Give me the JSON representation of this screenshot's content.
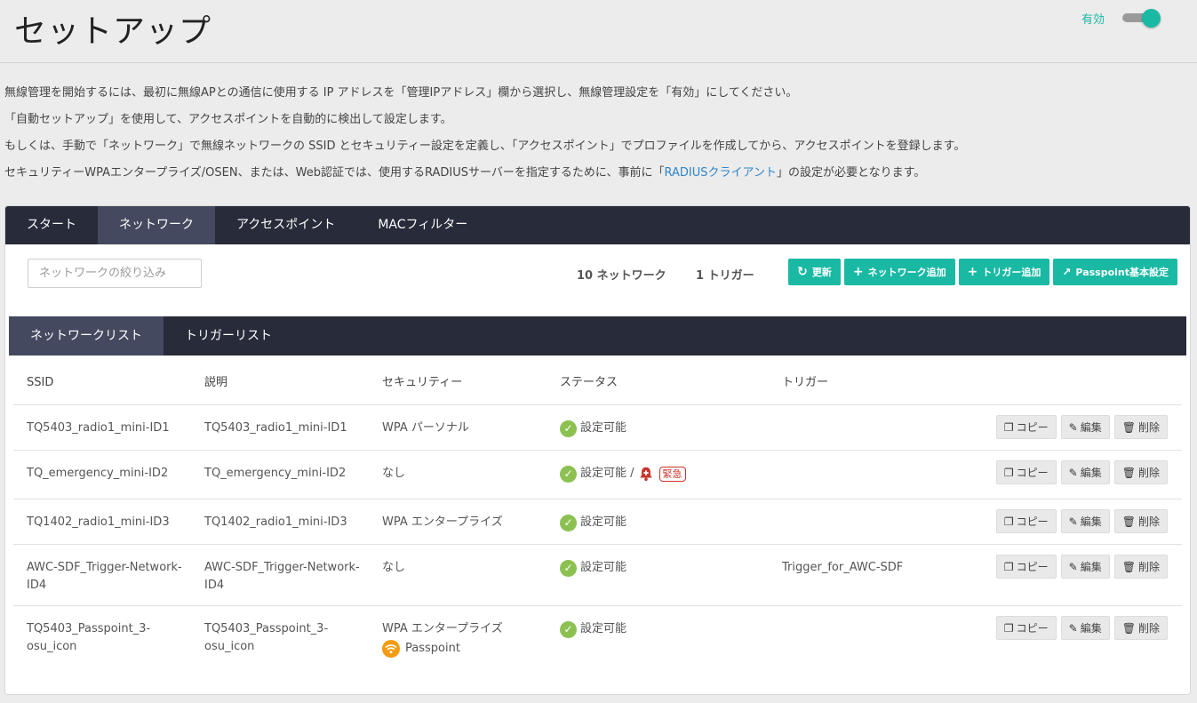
{
  "header": {
    "title": "セットアップ",
    "toggle_label": "有効",
    "toggle_on": true
  },
  "intro": {
    "line1": "無線管理を開始するには、最初に無線APとの通信に使用する IP アドレスを「管理IPアドレス」欄から選択し、無線管理設定を「有効」にしてください。",
    "line2": "「自動セットアップ」を使用して、アクセスポイントを自動的に検出して設定します。",
    "line3": "もしくは、手動で「ネットワーク」で無線ネットワークの SSID とセキュリティー設定を定義し、「アクセスポイント」でプロファイルを作成してから、アクセスポイントを登録します。",
    "line4_pre": "セキュリティーWPAエンタープライズ/OSEN、または、Web認証では、使用するRADIUSサーバーを指定するために、事前に「",
    "line4_link": "RADIUSクライアント",
    "line4_post": "」の設定が必要となります。"
  },
  "tabs": [
    {
      "label": "スタート"
    },
    {
      "label": "ネットワーク"
    },
    {
      "label": "アクセスポイント"
    },
    {
      "label": "MACフィルター"
    }
  ],
  "filter": {
    "placeholder": "ネットワークの絞り込み",
    "value": ""
  },
  "counts": {
    "networks": "10 ネットワーク",
    "triggers": "1 トリガー"
  },
  "toolbar": {
    "refresh": "更新",
    "add_network": "ネットワーク追加",
    "add_trigger": "トリガー追加",
    "passpoint": "Passpoint基本設定"
  },
  "subtabs": [
    {
      "label": "ネットワークリスト"
    },
    {
      "label": "トリガーリスト"
    }
  ],
  "columns": {
    "ssid": "SSID",
    "desc": "説明",
    "security": "セキュリティー",
    "status": "ステータス",
    "trigger": "トリガー"
  },
  "actions": {
    "copy": "コピー",
    "edit": "編集",
    "delete": "削除"
  },
  "rows": [
    {
      "ssid": "TQ5403_radio1_mini-ID1",
      "desc": "TQ5403_radio1_mini-ID1",
      "security": "WPA パーソナル",
      "status": "設定可能",
      "trigger": ""
    },
    {
      "ssid": "TQ_emergency_mini-ID2",
      "desc": "TQ_emergency_mini-ID2",
      "security": "なし",
      "status": "設定可能 /",
      "urgent": "緊急",
      "trigger": ""
    },
    {
      "ssid": "TQ1402_radio1_mini-ID3",
      "desc": "TQ1402_radio1_mini-ID3",
      "security": "WPA エンタープライズ",
      "status": "設定可能",
      "trigger": ""
    },
    {
      "ssid": "AWC-SDF_Trigger-Network-ID4",
      "desc": "AWC-SDF_Trigger-Network-ID4",
      "security": "なし",
      "status": "設定可能",
      "trigger": "Trigger_for_AWC-SDF"
    },
    {
      "ssid": "TQ5403_Passpoint_3-osu_icon",
      "desc": "TQ5403_Passpoint_3-osu_icon",
      "security": "WPA エンタープライズ",
      "passpoint": "Passpoint",
      "status": "設定可能",
      "trigger": ""
    }
  ],
  "colors": {
    "accent": "#1ab9a4",
    "tabbar": "#272b3a",
    "tab_active": "#44495f",
    "ok": "#8cc152",
    "alert": "#c8352b",
    "passpoint": "#f39c12",
    "link": "#2f86c9"
  }
}
